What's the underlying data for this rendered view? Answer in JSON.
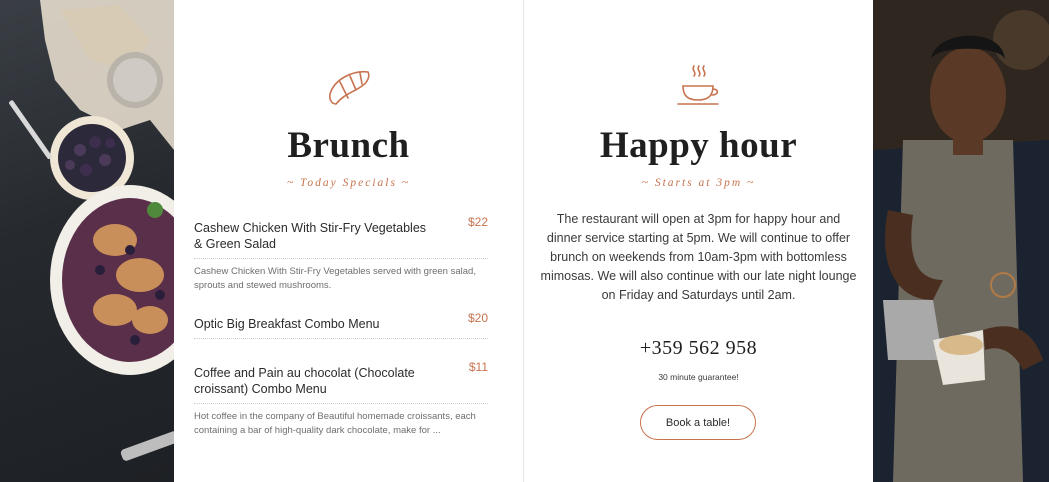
{
  "brunch": {
    "title": "Brunch",
    "subtitle": "~ Today Specials ~",
    "icon": "croissant-icon",
    "items": [
      {
        "name": "Cashew Chicken With Stir-Fry Vegetables & Green Salad",
        "price": "$22",
        "description": "Cashew Chicken With Stir-Fry Vegetables served with green salad, sprouts and stewed mushrooms."
      },
      {
        "name": "Optic Big Breakfast Combo Menu",
        "price": "$20",
        "description": ""
      },
      {
        "name": "Coffee and Pain au chocolat (Chocolate croissant) Combo Menu",
        "price": "$11",
        "description": "Hot coffee in the company of Beautiful homemade croissants, each containing a bar of high-quality dark chocolate, make for ..."
      }
    ]
  },
  "happy_hour": {
    "title": "Happy hour",
    "subtitle": "~ Starts at 3pm ~",
    "icon": "coffee-cup-icon",
    "text": "The restaurant will open at 3pm for happy hour and dinner service starting at 5pm. We will continue to offer brunch on weekends from 10am-3pm with bottomless mimosas. We will also continue with our late night lounge on Friday and Saturdays until 2am.",
    "phone": "+359 562 958",
    "guarantee": "30 minute guarantee!",
    "button_label": "Book a table!"
  },
  "colors": {
    "accent": "#c8734f",
    "heading": "#1f1f1f"
  }
}
